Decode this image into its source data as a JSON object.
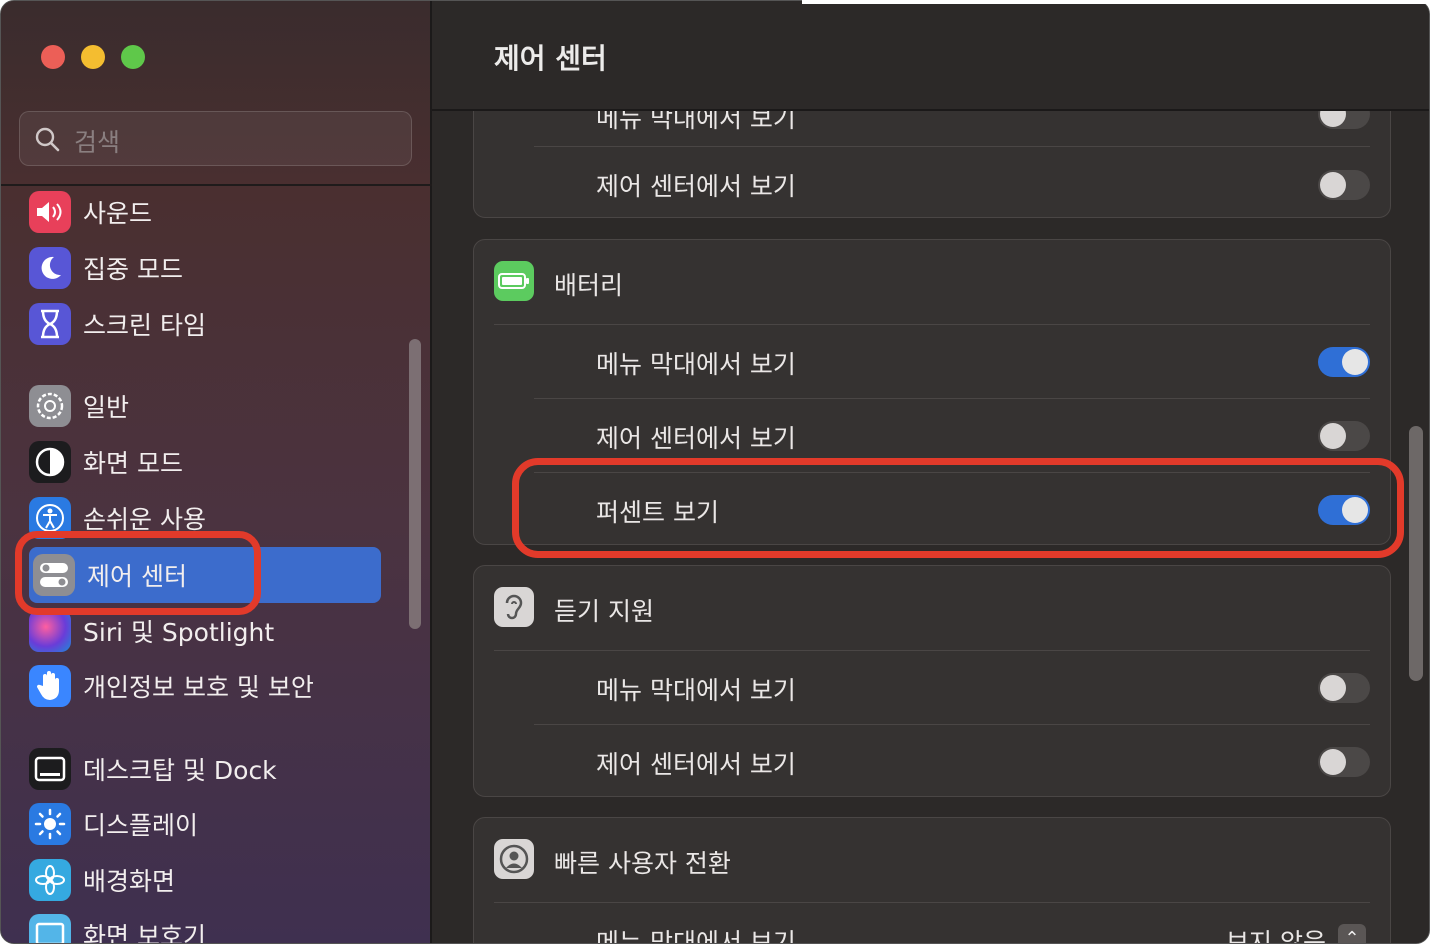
{
  "page_title": "제어 센터",
  "search": {
    "placeholder": "검색"
  },
  "sidebar": {
    "items": [
      {
        "label": "사운드",
        "icon": "speaker-icon",
        "color": "#e8405a"
      },
      {
        "label": "집중 모드",
        "icon": "moon-icon",
        "color": "#5856d6"
      },
      {
        "label": "스크린 타임",
        "icon": "hourglass-icon",
        "color": "#5856d6"
      },
      {
        "label": "일반",
        "icon": "gear-icon",
        "color": "#8e8e93"
      },
      {
        "label": "화면 모드",
        "icon": "appearance-icon",
        "color": "#1c1c1e"
      },
      {
        "label": "손쉬운 사용",
        "icon": "accessibility-icon",
        "color": "#2a7ae2"
      },
      {
        "label": "제어 센터",
        "icon": "control-center-icon",
        "color": "#8e8e93",
        "selected": true
      },
      {
        "label": "Siri 및 Spotlight",
        "icon": "siri-icon",
        "color": "#7b3fd1"
      },
      {
        "label": "개인정보 보호 및 보안",
        "icon": "hand-icon",
        "color": "#3a86ff"
      },
      {
        "label": "데스크탑 및 Dock",
        "icon": "dock-icon",
        "color": "#1c1c1e"
      },
      {
        "label": "디스플레이",
        "icon": "sun-icon",
        "color": "#2a7ae2"
      },
      {
        "label": "배경화면",
        "icon": "flower-icon",
        "color": "#35a9e0"
      },
      {
        "label": "화면 보호기",
        "icon": "screensaver-icon",
        "color": "#53b5e8"
      }
    ]
  },
  "main": {
    "top_card": {
      "rows": [
        {
          "label": "메뉴 막대에서 보기",
          "on": false
        },
        {
          "label": "제어 센터에서 보기",
          "on": false
        }
      ]
    },
    "battery": {
      "title": "배터리",
      "rows": [
        {
          "label": "메뉴 막대에서 보기",
          "on": true
        },
        {
          "label": "제어 센터에서 보기",
          "on": false
        },
        {
          "label": "퍼센트 보기",
          "on": true
        }
      ]
    },
    "hearing": {
      "title": "듣기 지원",
      "rows": [
        {
          "label": "메뉴 막대에서 보기",
          "on": false
        },
        {
          "label": "제어 센터에서 보기",
          "on": false
        }
      ]
    },
    "fast_user": {
      "title": "빠른 사용자 전환",
      "rows": [
        {
          "label": "메뉴 막대에서 보기",
          "value": "보지 않음"
        }
      ]
    }
  },
  "colors": {
    "accent": "#2f6fd6",
    "highlight": "#e23a2a",
    "battery_green": "#5ccb5f"
  }
}
